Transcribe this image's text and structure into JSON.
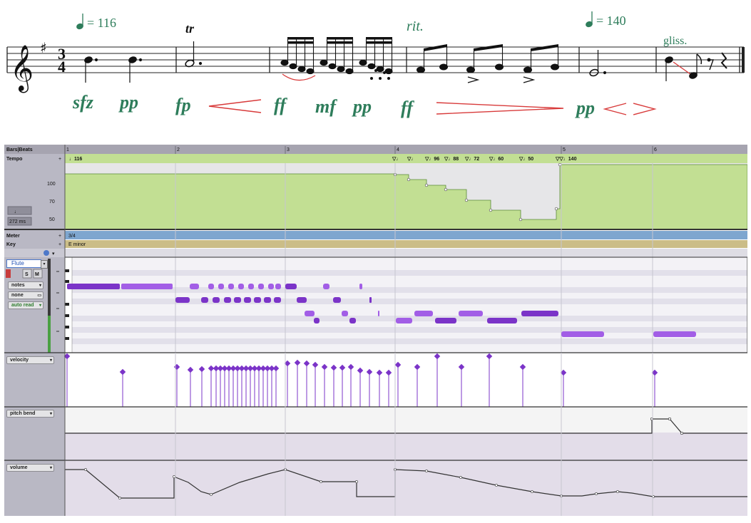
{
  "score": {
    "tempo_marks": [
      "= 116",
      "= 140"
    ],
    "expressions": {
      "trill": "tr",
      "rit": "rit.",
      "gliss": "gliss."
    },
    "time_signature": {
      "top": "3",
      "bottom": "4"
    },
    "dynamics": [
      "sfz",
      "pp",
      "fp",
      "ff",
      "mf",
      "pp",
      "ff",
      "pp"
    ]
  },
  "timeline": {
    "ruler_title": "Bars|Beats",
    "bars": [
      "1",
      "2",
      "3",
      "4",
      "5",
      "6"
    ]
  },
  "tempo_track": {
    "label": "Tempo",
    "events": [
      "116",
      "",
      "",
      "96",
      "88",
      "72",
      "60",
      "50",
      "140"
    ],
    "axis": [
      "100",
      "70",
      "50"
    ],
    "note_selector": "♩",
    "resolution": "272 ms",
    "values": [
      116,
      116,
      106,
      96,
      88,
      72,
      60,
      50,
      140
    ]
  },
  "meter_track": {
    "label": "Meter",
    "value": "3/4"
  },
  "key_track": {
    "label": "Key",
    "value": "E minor"
  },
  "midi_track": {
    "name": "Flute",
    "rec": "",
    "solo": "S",
    "mute": "M",
    "view": "notes",
    "automation": "none",
    "mode": "auto read"
  },
  "lanes": {
    "velocity": "velocity",
    "pitch_bend": "pitch bend",
    "volume": "volume"
  },
  "colors": {
    "tempo_fill": "#c2df93",
    "meter_bg": "#7ea6cf",
    "key_bg": "#cbbd87",
    "note_dark": "#7b34c8",
    "note_light": "#a25ee6",
    "score_green": "#2e7d5b",
    "hairpin_red": "#d83a3a"
  }
}
